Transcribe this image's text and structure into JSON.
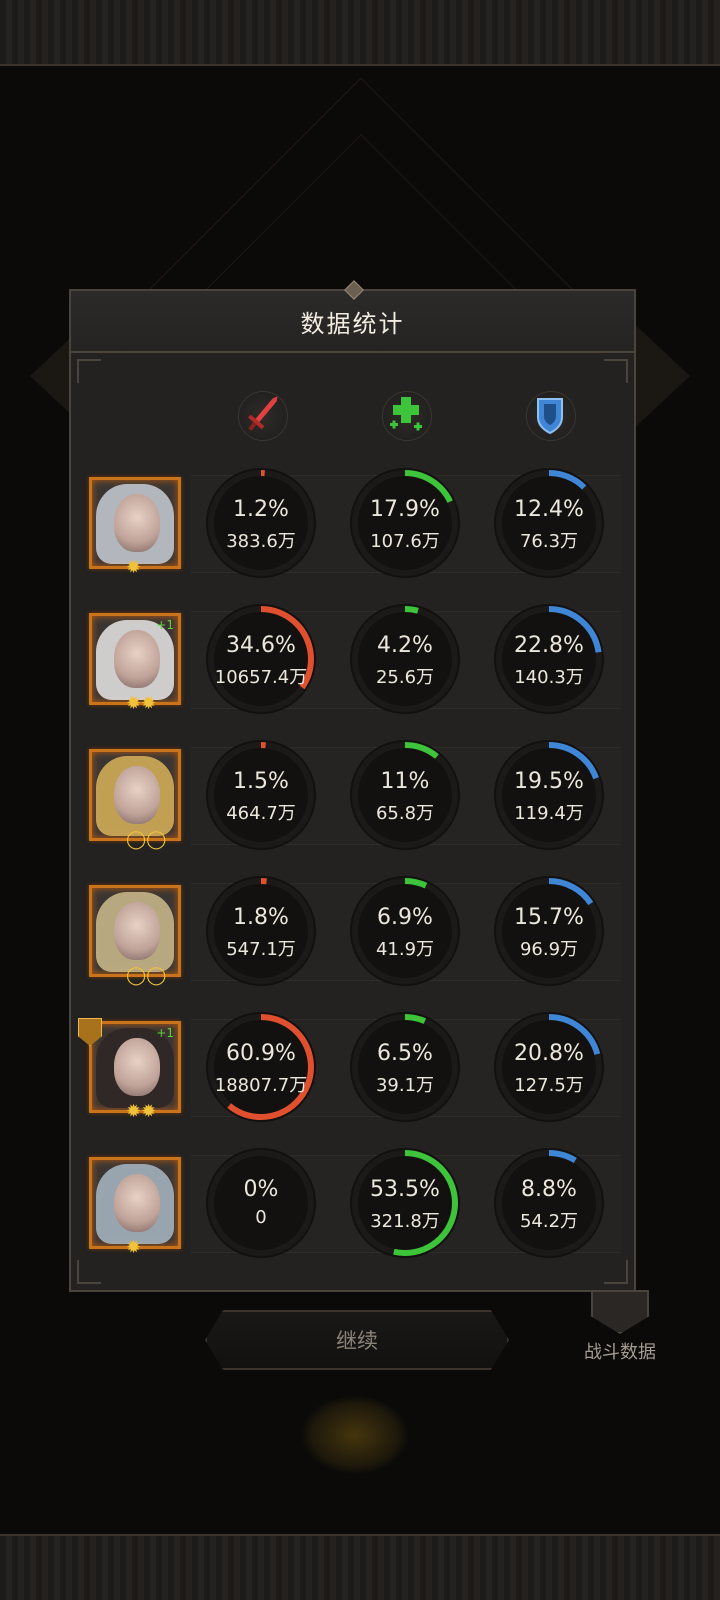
{
  "panel": {
    "title": "数据统计"
  },
  "columns": [
    {
      "icon": "sword-icon",
      "color": "#e04040"
    },
    {
      "icon": "heal-cross-icon",
      "color": "#3ec43a"
    },
    {
      "icon": "shield-icon",
      "color": "#3f86d6"
    }
  ],
  "colors": {
    "damage": "#e0502e",
    "heal": "#3ec43a",
    "defense": "#3f86d6",
    "portrait_frame": "#c9741a"
  },
  "heroes": [
    {
      "hair_color": "#c8ccd6",
      "stars": "✹",
      "damage": {
        "pct": "1.2%",
        "amount": "383.6万",
        "ratio": 0.012
      },
      "heal": {
        "pct": "17.9%",
        "amount": "107.6万",
        "ratio": 0.179
      },
      "defense": {
        "pct": "12.4%",
        "amount": "76.3万",
        "ratio": 0.124
      }
    },
    {
      "hair_color": "#eae6e8",
      "stars": "✹✹",
      "plus": "+1",
      "damage": {
        "pct": "34.6%",
        "amount": "10657.4万",
        "ratio": 0.346
      },
      "heal": {
        "pct": "4.2%",
        "amount": "25.6万",
        "ratio": 0.042
      },
      "defense": {
        "pct": "22.8%",
        "amount": "140.3万",
        "ratio": 0.228
      }
    },
    {
      "hair_color": "#d9b35a",
      "stars": "◯◯",
      "damage": {
        "pct": "1.5%",
        "amount": "464.7万",
        "ratio": 0.015
      },
      "heal": {
        "pct": "11%",
        "amount": "65.8万",
        "ratio": 0.11
      },
      "defense": {
        "pct": "19.5%",
        "amount": "119.4万",
        "ratio": 0.195
      }
    },
    {
      "hair_color": "#cfbc8e",
      "stars": "◯◯",
      "damage": {
        "pct": "1.8%",
        "amount": "547.1万",
        "ratio": 0.018
      },
      "heal": {
        "pct": "6.9%",
        "amount": "41.9万",
        "ratio": 0.069
      },
      "defense": {
        "pct": "15.7%",
        "amount": "96.9万",
        "ratio": 0.157
      }
    },
    {
      "hair_color": "#2e2624",
      "stars": "✹✹",
      "plus": "+1",
      "emblem": true,
      "damage": {
        "pct": "60.9%",
        "amount": "18807.7万",
        "ratio": 0.609
      },
      "heal": {
        "pct": "6.5%",
        "amount": "39.1万",
        "ratio": 0.065
      },
      "defense": {
        "pct": "20.8%",
        "amount": "127.5万",
        "ratio": 0.208
      }
    },
    {
      "hair_color": "#a9b8c6",
      "stars": "✹",
      "damage": {
        "pct": "0%",
        "amount": "0",
        "ratio": 0
      },
      "heal": {
        "pct": "53.5%",
        "amount": "321.8万",
        "ratio": 0.535
      },
      "defense": {
        "pct": "8.8%",
        "amount": "54.2万",
        "ratio": 0.088
      }
    }
  ],
  "continue_label": "继续",
  "battle_data_label": "战斗数据"
}
